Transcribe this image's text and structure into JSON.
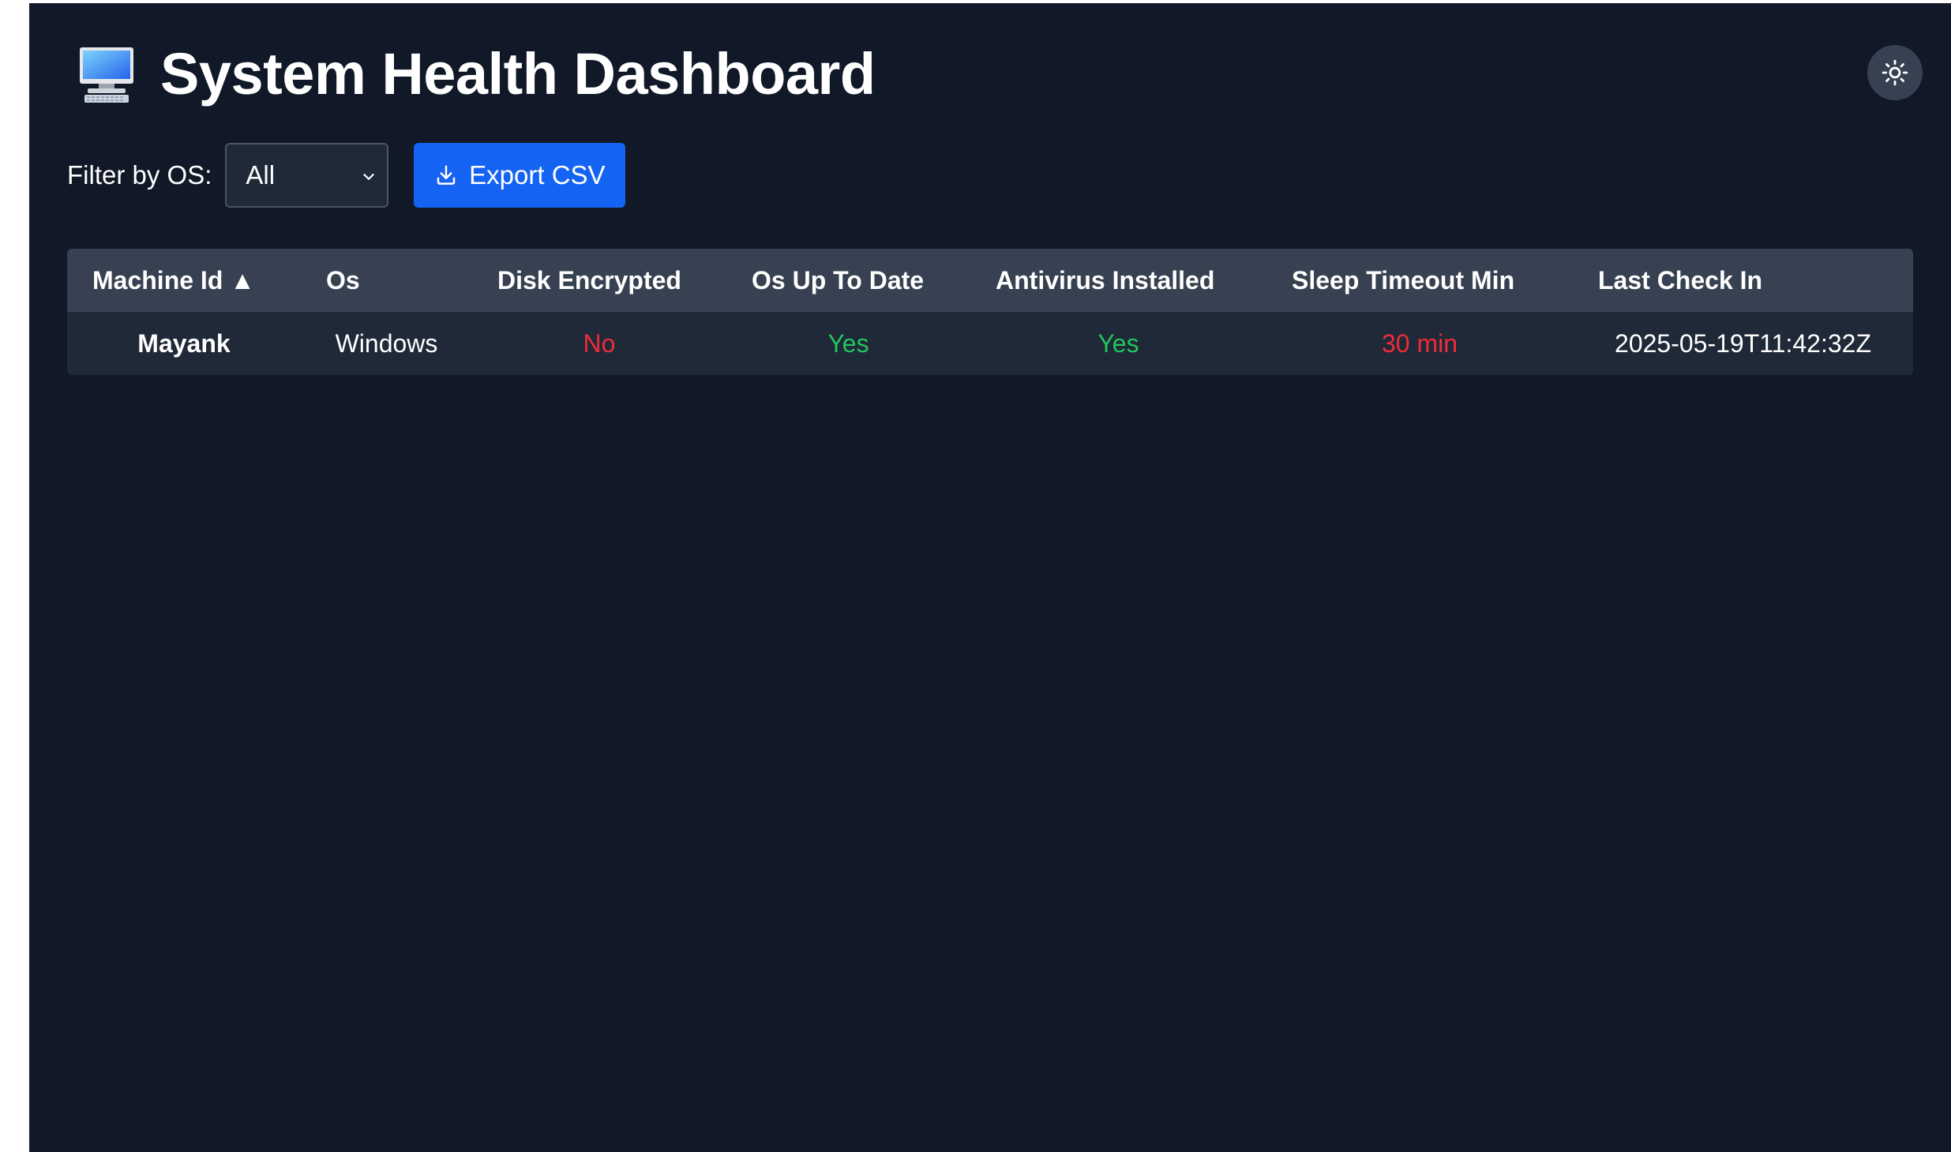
{
  "header": {
    "title": "System Health Dashboard",
    "icon": "desktop-computer-icon"
  },
  "theme_toggle": {
    "icon": "sun-icon"
  },
  "controls": {
    "filter_label": "Filter by OS:",
    "os_select_value": "All",
    "export_label": "Export CSV",
    "export_icon": "download-icon"
  },
  "table": {
    "columns": [
      "Machine Id ▲",
      "Os",
      "Disk Encrypted",
      "Os Up To Date",
      "Antivirus Installed",
      "Sleep Timeout Min",
      "Last Check In"
    ],
    "rows": [
      {
        "machine_id": "Mayank",
        "os": "Windows",
        "disk_encrypted": "No",
        "os_up_to_date": "Yes",
        "antivirus_installed": "Yes",
        "sleep_timeout_min": "30 min",
        "last_check_in": "2025-05-19T11:42:32Z"
      }
    ]
  },
  "colors": {
    "background": "#111827",
    "header_row": "#374151",
    "data_row": "#1f2937",
    "accent": "#1463f3",
    "bad": "#ef2b3a",
    "good": "#22c55e"
  }
}
